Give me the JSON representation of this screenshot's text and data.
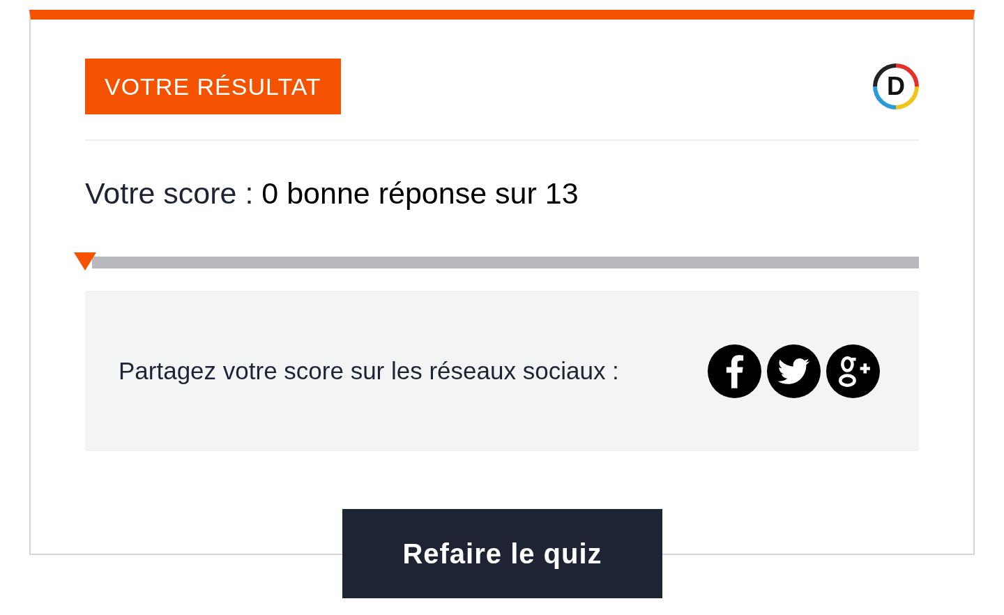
{
  "badge": "VOTRE RÉSULTAT",
  "logo": {
    "letter": "D"
  },
  "score": {
    "label": "Votre score :",
    "value": "0 bonne réponse sur 13"
  },
  "progress": {
    "level": 0
  },
  "share": {
    "text": "Partagez votre score sur les réseaux sociaux :",
    "networks": [
      {
        "kind": "facebook"
      },
      {
        "kind": "twitter"
      },
      {
        "kind": "googleplus"
      }
    ]
  },
  "button": {
    "label": "Refaire le quiz"
  }
}
